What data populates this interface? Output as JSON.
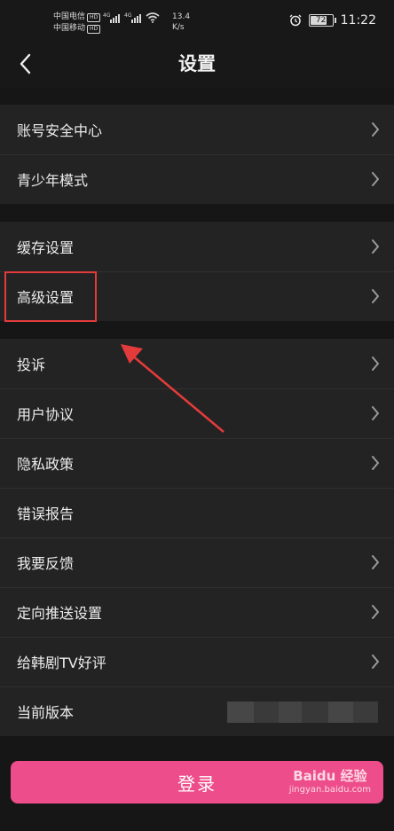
{
  "status_bar": {
    "carrier1": "中国电信",
    "carrier2": "中国移动",
    "hd": "HD",
    "network": "4G",
    "speed_value": "13.4",
    "speed_unit": "K/s",
    "battery": "72",
    "time": "11:22"
  },
  "header": {
    "title": "设置"
  },
  "groups": {
    "account": [
      "账号安全中心",
      "青少年模式"
    ],
    "storage": [
      "缓存设置",
      "高级设置"
    ],
    "misc": [
      "投诉",
      "用户协议",
      "隐私政策",
      "错误报告",
      "我要反馈",
      "定向推送设置",
      "给韩剧TV好评",
      "当前版本"
    ]
  },
  "login_button": "登录",
  "watermark": {
    "brand": "Baidu 经验",
    "url": "jingyan.baidu.com"
  },
  "colors": {
    "background": "#161616",
    "row_background": "#232323",
    "accent_pink": "#ed4d8a",
    "annotation_red": "#e33b3b"
  }
}
